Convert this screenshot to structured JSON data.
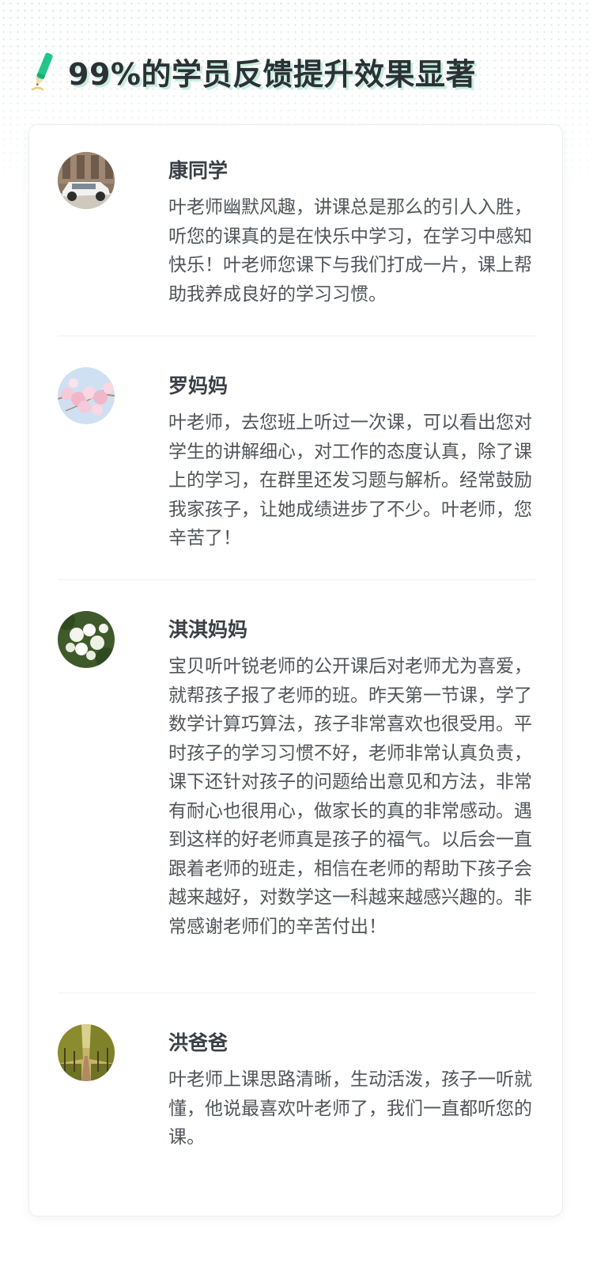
{
  "header": {
    "title": "99%的学员反馈提升效果显著",
    "icon": "pencil-icon"
  },
  "colors": {
    "accent": "#22c58a",
    "title_shadow": "#c7eedd",
    "title": "#2b3136",
    "body_text": "#50555a"
  },
  "reviews": [
    {
      "name": "康同学",
      "avatar": "car-photo-avatar",
      "text": "叶老师幽默风趣，讲课总是那么的引人入胜，听您的课真的是在快乐中学习，在学习中感知快乐！叶老师您课下与我们打成一片，课上帮助我养成良好的学习习惯。"
    },
    {
      "name": "罗妈妈",
      "avatar": "cherry-blossom-avatar",
      "text": "叶老师，去您班上听过一次课，可以看出您对学生的讲解细心，对工作的态度认真，除了课上的学习，在群里还发习题与解析。经常鼓励我家孩子，让她成绩进步了不少。叶老师，您辛苦了！"
    },
    {
      "name": "淇淇妈妈",
      "avatar": "white-flowers-avatar",
      "text": "宝贝听叶锐老师的公开课后对老师尤为喜爱，就帮孩子报了老师的班。昨天第一节课，学了数学计算巧算法，孩子非常喜欢也很受用。平时孩子的学习习惯不好，老师非常认真负责，课下还针对孩子的问题给出意见和方法，非常有耐心也很用心，做家长的真的非常感动。遇到这样的好老师真是孩子的福气。以后会一直跟着老师的班走，相信在老师的帮助下孩子会越来越好，对数学这一科越来越感兴趣的。非常感谢老师们的辛苦付出！"
    },
    {
      "name": "洪爸爸",
      "avatar": "tree-avenue-avatar",
      "text": "叶老师上课思路清晰，生动活泼，孩子一听就懂，他说最喜欢叶老师了，我们一直都听您的课。"
    }
  ]
}
